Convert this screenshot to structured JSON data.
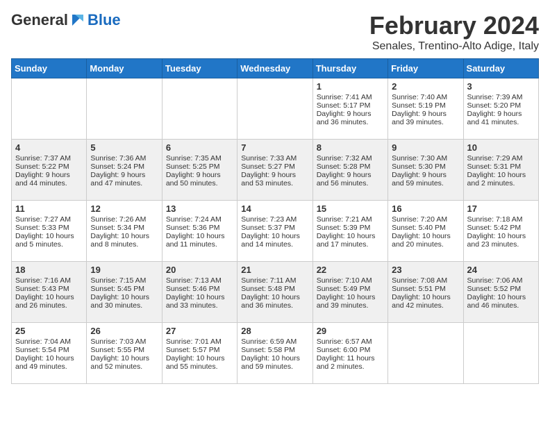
{
  "header": {
    "logo_general": "General",
    "logo_blue": "Blue",
    "title": "February 2024",
    "subtitle": "Senales, Trentino-Alto Adige, Italy"
  },
  "weekdays": [
    "Sunday",
    "Monday",
    "Tuesday",
    "Wednesday",
    "Thursday",
    "Friday",
    "Saturday"
  ],
  "weeks": [
    [
      {
        "day": "",
        "sunrise": "",
        "sunset": "",
        "daylight": ""
      },
      {
        "day": "",
        "sunrise": "",
        "sunset": "",
        "daylight": ""
      },
      {
        "day": "",
        "sunrise": "",
        "sunset": "",
        "daylight": ""
      },
      {
        "day": "",
        "sunrise": "",
        "sunset": "",
        "daylight": ""
      },
      {
        "day": "1",
        "sunrise": "Sunrise: 7:41 AM",
        "sunset": "Sunset: 5:17 PM",
        "daylight": "Daylight: 9 hours and 36 minutes."
      },
      {
        "day": "2",
        "sunrise": "Sunrise: 7:40 AM",
        "sunset": "Sunset: 5:19 PM",
        "daylight": "Daylight: 9 hours and 39 minutes."
      },
      {
        "day": "3",
        "sunrise": "Sunrise: 7:39 AM",
        "sunset": "Sunset: 5:20 PM",
        "daylight": "Daylight: 9 hours and 41 minutes."
      }
    ],
    [
      {
        "day": "4",
        "sunrise": "Sunrise: 7:37 AM",
        "sunset": "Sunset: 5:22 PM",
        "daylight": "Daylight: 9 hours and 44 minutes."
      },
      {
        "day": "5",
        "sunrise": "Sunrise: 7:36 AM",
        "sunset": "Sunset: 5:24 PM",
        "daylight": "Daylight: 9 hours and 47 minutes."
      },
      {
        "day": "6",
        "sunrise": "Sunrise: 7:35 AM",
        "sunset": "Sunset: 5:25 PM",
        "daylight": "Daylight: 9 hours and 50 minutes."
      },
      {
        "day": "7",
        "sunrise": "Sunrise: 7:33 AM",
        "sunset": "Sunset: 5:27 PM",
        "daylight": "Daylight: 9 hours and 53 minutes."
      },
      {
        "day": "8",
        "sunrise": "Sunrise: 7:32 AM",
        "sunset": "Sunset: 5:28 PM",
        "daylight": "Daylight: 9 hours and 56 minutes."
      },
      {
        "day": "9",
        "sunrise": "Sunrise: 7:30 AM",
        "sunset": "Sunset: 5:30 PM",
        "daylight": "Daylight: 9 hours and 59 minutes."
      },
      {
        "day": "10",
        "sunrise": "Sunrise: 7:29 AM",
        "sunset": "Sunset: 5:31 PM",
        "daylight": "Daylight: 10 hours and 2 minutes."
      }
    ],
    [
      {
        "day": "11",
        "sunrise": "Sunrise: 7:27 AM",
        "sunset": "Sunset: 5:33 PM",
        "daylight": "Daylight: 10 hours and 5 minutes."
      },
      {
        "day": "12",
        "sunrise": "Sunrise: 7:26 AM",
        "sunset": "Sunset: 5:34 PM",
        "daylight": "Daylight: 10 hours and 8 minutes."
      },
      {
        "day": "13",
        "sunrise": "Sunrise: 7:24 AM",
        "sunset": "Sunset: 5:36 PM",
        "daylight": "Daylight: 10 hours and 11 minutes."
      },
      {
        "day": "14",
        "sunrise": "Sunrise: 7:23 AM",
        "sunset": "Sunset: 5:37 PM",
        "daylight": "Daylight: 10 hours and 14 minutes."
      },
      {
        "day": "15",
        "sunrise": "Sunrise: 7:21 AM",
        "sunset": "Sunset: 5:39 PM",
        "daylight": "Daylight: 10 hours and 17 minutes."
      },
      {
        "day": "16",
        "sunrise": "Sunrise: 7:20 AM",
        "sunset": "Sunset: 5:40 PM",
        "daylight": "Daylight: 10 hours and 20 minutes."
      },
      {
        "day": "17",
        "sunrise": "Sunrise: 7:18 AM",
        "sunset": "Sunset: 5:42 PM",
        "daylight": "Daylight: 10 hours and 23 minutes."
      }
    ],
    [
      {
        "day": "18",
        "sunrise": "Sunrise: 7:16 AM",
        "sunset": "Sunset: 5:43 PM",
        "daylight": "Daylight: 10 hours and 26 minutes."
      },
      {
        "day": "19",
        "sunrise": "Sunrise: 7:15 AM",
        "sunset": "Sunset: 5:45 PM",
        "daylight": "Daylight: 10 hours and 30 minutes."
      },
      {
        "day": "20",
        "sunrise": "Sunrise: 7:13 AM",
        "sunset": "Sunset: 5:46 PM",
        "daylight": "Daylight: 10 hours and 33 minutes."
      },
      {
        "day": "21",
        "sunrise": "Sunrise: 7:11 AM",
        "sunset": "Sunset: 5:48 PM",
        "daylight": "Daylight: 10 hours and 36 minutes."
      },
      {
        "day": "22",
        "sunrise": "Sunrise: 7:10 AM",
        "sunset": "Sunset: 5:49 PM",
        "daylight": "Daylight: 10 hours and 39 minutes."
      },
      {
        "day": "23",
        "sunrise": "Sunrise: 7:08 AM",
        "sunset": "Sunset: 5:51 PM",
        "daylight": "Daylight: 10 hours and 42 minutes."
      },
      {
        "day": "24",
        "sunrise": "Sunrise: 7:06 AM",
        "sunset": "Sunset: 5:52 PM",
        "daylight": "Daylight: 10 hours and 46 minutes."
      }
    ],
    [
      {
        "day": "25",
        "sunrise": "Sunrise: 7:04 AM",
        "sunset": "Sunset: 5:54 PM",
        "daylight": "Daylight: 10 hours and 49 minutes."
      },
      {
        "day": "26",
        "sunrise": "Sunrise: 7:03 AM",
        "sunset": "Sunset: 5:55 PM",
        "daylight": "Daylight: 10 hours and 52 minutes."
      },
      {
        "day": "27",
        "sunrise": "Sunrise: 7:01 AM",
        "sunset": "Sunset: 5:57 PM",
        "daylight": "Daylight: 10 hours and 55 minutes."
      },
      {
        "day": "28",
        "sunrise": "Sunrise: 6:59 AM",
        "sunset": "Sunset: 5:58 PM",
        "daylight": "Daylight: 10 hours and 59 minutes."
      },
      {
        "day": "29",
        "sunrise": "Sunrise: 6:57 AM",
        "sunset": "Sunset: 6:00 PM",
        "daylight": "Daylight: 11 hours and 2 minutes."
      },
      {
        "day": "",
        "sunrise": "",
        "sunset": "",
        "daylight": ""
      },
      {
        "day": "",
        "sunrise": "",
        "sunset": "",
        "daylight": ""
      }
    ]
  ]
}
